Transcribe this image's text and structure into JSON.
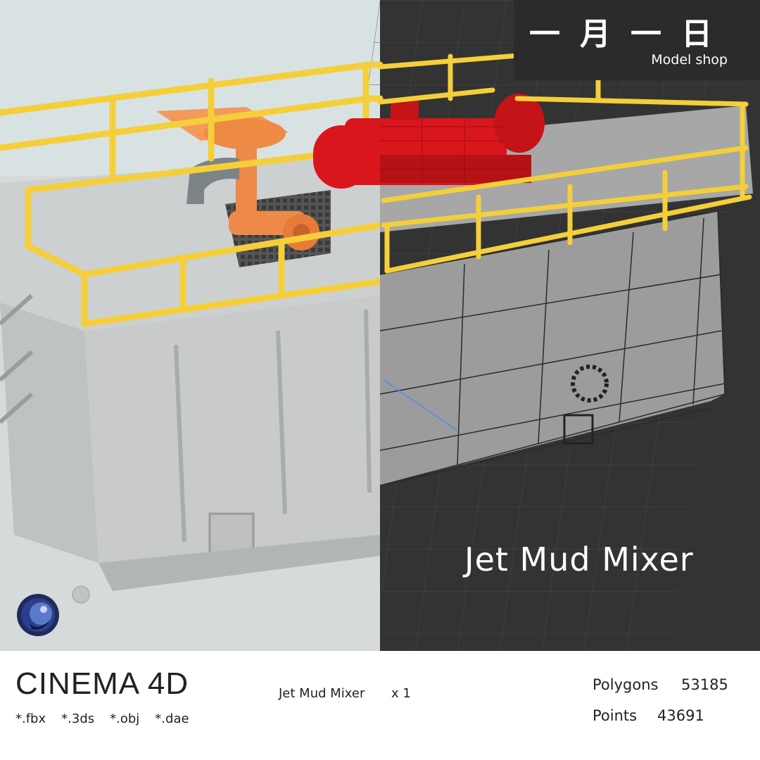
{
  "shop": {
    "logo_text": "一月一日",
    "subtitle": "Model shop"
  },
  "model": {
    "title": "Jet Mud Mixer"
  },
  "footer": {
    "software": "CINEMA 4D",
    "formats": [
      "*.fbx",
      "*.3ds",
      "*.obj",
      "*.dae"
    ],
    "item_name": "Jet Mud Mixer",
    "item_qty": "x 1",
    "stats": [
      {
        "label": "Polygons",
        "value": "53185"
      },
      {
        "label": "Points",
        "value": "43691"
      }
    ]
  },
  "icons": {
    "software_logo": "cinema4d-logo-icon"
  },
  "colors": {
    "render_bg": "#d9e2e3",
    "viewport_bg": "#333333",
    "railing": "#f4cf3a",
    "motor": "#d9161c",
    "pipe": "#f39a5a",
    "badge_bg": "#2b2b2b"
  }
}
